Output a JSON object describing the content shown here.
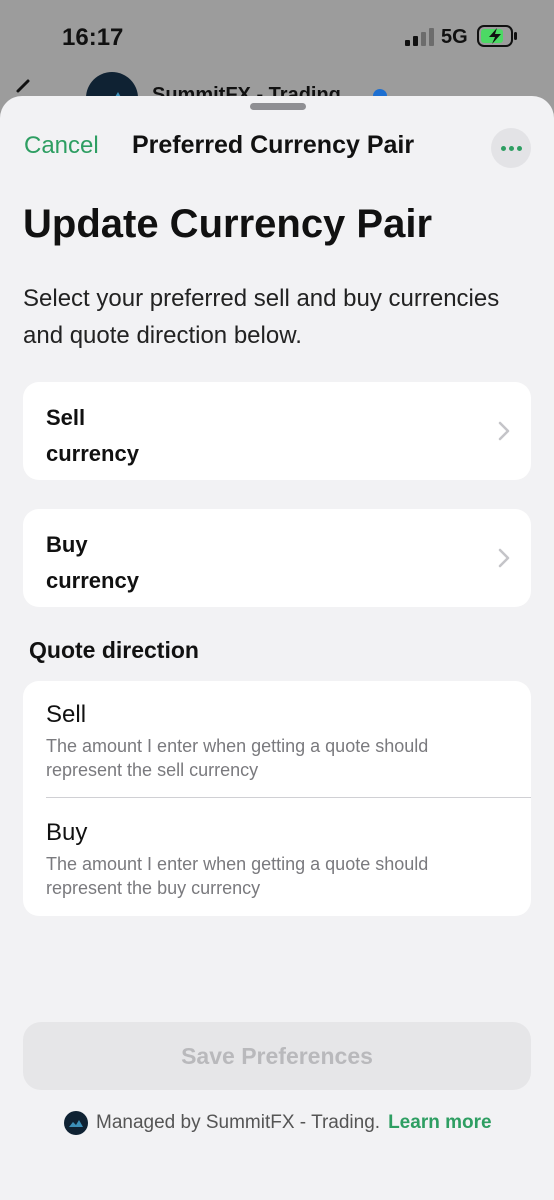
{
  "status_bar": {
    "time": "16:17",
    "network": "5G",
    "icons": [
      "signal-icon",
      "battery-charging-icon"
    ]
  },
  "background_header": {
    "title": "SummitFX - Trading",
    "icons": [
      "back-chevron-icon",
      "verified-badge-icon"
    ]
  },
  "sheet": {
    "nav": {
      "cancel_label": "Cancel",
      "title": "Preferred Currency Pair",
      "more_icon": "ellipsis-icon"
    },
    "heading": "Update Currency Pair",
    "description": "Select your preferred sell and buy currencies and quote direction below.",
    "currency_selectors": [
      {
        "label_line1": "Sell",
        "label_line2": "currency",
        "icon": "chevron-right-icon"
      },
      {
        "label_line1": "Buy",
        "label_line2": "currency",
        "icon": "chevron-right-icon"
      }
    ],
    "quote_direction": {
      "section_label": "Quote direction",
      "options": [
        {
          "title": "Sell",
          "description": "The amount I enter when getting a quote should represent the sell currency"
        },
        {
          "title": "Buy",
          "description": "The amount I enter when getting a quote should represent the buy currency"
        }
      ]
    },
    "save_label": "Save Preferences",
    "footer": {
      "managed_text": "Managed by SummitFX - Trading.",
      "link_label": "Learn more"
    }
  },
  "colors": {
    "accent": "#2e9e62",
    "sheet_background": "#f2f2f4",
    "card_background": "#ffffff",
    "disabled_button": "#e6e6e8",
    "disabled_text": "#b9b9bc",
    "brand_dark": "#0f2233"
  }
}
